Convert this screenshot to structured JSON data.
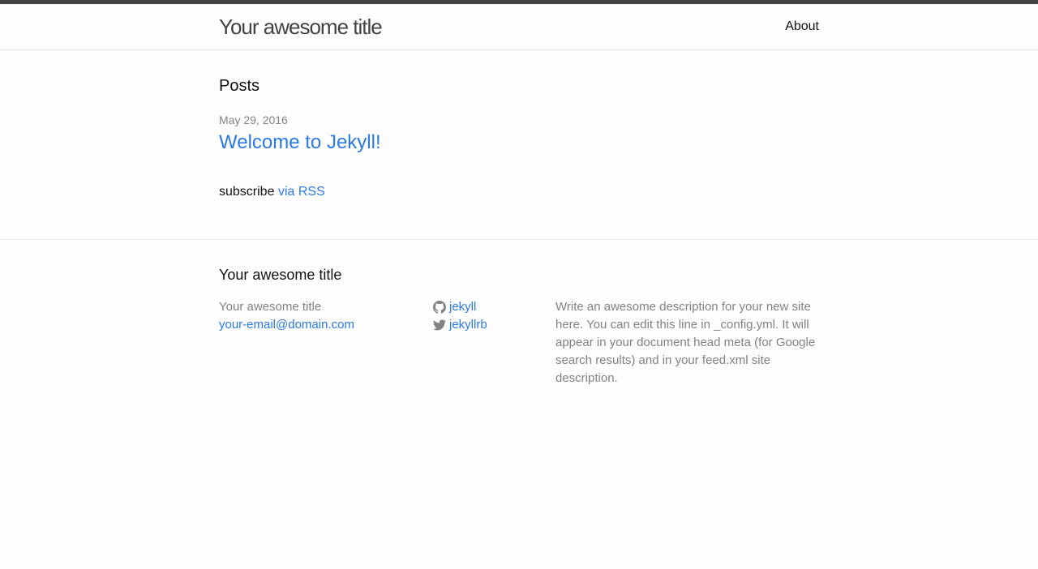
{
  "header": {
    "site_title": "Your awesome title",
    "nav": [
      {
        "label": "About"
      }
    ]
  },
  "main": {
    "heading": "Posts",
    "posts": [
      {
        "date": "May 29, 2016",
        "title": "Welcome to Jekyll!"
      }
    ],
    "rss": {
      "prefix": "subscribe",
      "link_label": "via RSS"
    }
  },
  "footer": {
    "heading": "Your awesome title",
    "col1": {
      "name": "Your awesome title",
      "email": "your-email@domain.com"
    },
    "social": [
      {
        "icon": "github-icon",
        "label": "jekyll"
      },
      {
        "icon": "twitter-icon",
        "label": "jekyllrb"
      }
    ],
    "description": "Write an awesome description for your new site here. You can edit this line in _config.yml. It will appear in your document head meta (for Google search results) and in your feed.xml site description."
  },
  "colors": {
    "link": "#2a7ae2",
    "text": "#111111",
    "muted": "#828282",
    "top_bar": "#424242",
    "background": "#fdfdfd",
    "border": "#e8e8e8"
  }
}
